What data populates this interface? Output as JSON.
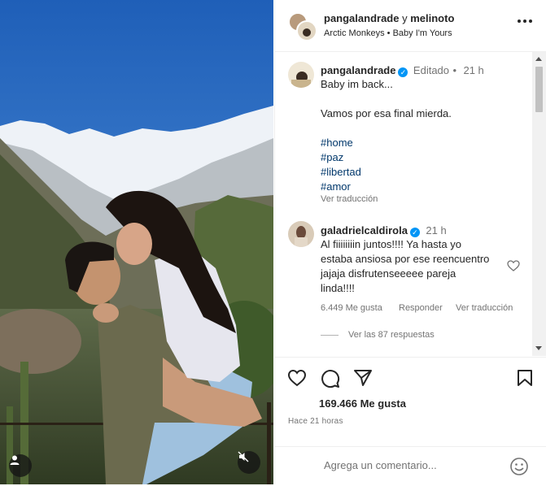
{
  "post": {
    "image_alt": "Pareja abrazándose frente a montañas nevadas",
    "user_icon": "user-tag-icon",
    "mute_icon": "audio-muted-icon"
  },
  "header": {
    "user1": "pangalandrade",
    "conj": "y",
    "user2": "melinoto",
    "artist": "Arctic Monkeys",
    "sep": "•",
    "song": "Baby I'm Yours"
  },
  "caption": {
    "username": "pangalandrade",
    "edited": "Editado",
    "sep": "•",
    "time": "21 h",
    "lines": [
      "Baby im back...",
      "Vamos por esa final mierda."
    ],
    "hashtags": [
      "#home",
      "#paz",
      "#libertad",
      "#amor"
    ],
    "translate": "Ver traducción"
  },
  "comment": {
    "username": "galadrielcaldirola",
    "time": "21 h",
    "lines": [
      "Al fiiiiiiiin juntos!!!! Ya hasta yo",
      "estaba ansiosa por ese reencuentro",
      "jajaja disfrutenseeeee pareja",
      "linda!!!!"
    ],
    "likes": "6.449 Me gusta",
    "reply": "Responder",
    "translate": "Ver traducción",
    "view_replies": "Ver las 87 respuestas"
  },
  "footer": {
    "likes": "169.466 Me gusta",
    "time": "Hace 21 horas",
    "placeholder": "Agrega un comentario..."
  },
  "colors": {
    "link": "#00376b",
    "verified": "#0095f6",
    "secondary": "#737373"
  }
}
